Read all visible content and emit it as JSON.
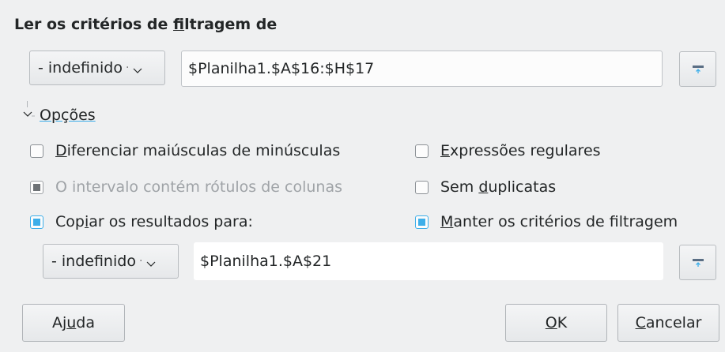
{
  "heading": {
    "pre": "Ler os critérios de ",
    "accel": "f",
    "post": "iltragem de"
  },
  "source": {
    "combo_value": "- indefinido",
    "range_value": "$Planilha1.$A$16:$H$17"
  },
  "options_expander": {
    "label": "Opções",
    "expanded": true
  },
  "options": {
    "case_sensitive": {
      "pre": "",
      "accel": "D",
      "post": "iferenciar maiúsculas de minúsculas",
      "checked": false
    },
    "regex": {
      "pre": "",
      "accel": "E",
      "post": "xpressões regulares",
      "checked": false
    },
    "contains_labels": {
      "label": "O intervalo contém rótulos de colunas",
      "checked": true,
      "disabled": true
    },
    "no_duplicates": {
      "pre": "Sem ",
      "accel": "d",
      "post": "uplicatas",
      "checked": false
    },
    "copy_results": {
      "pre": "Cop",
      "accel": "i",
      "post": "ar os resultados para:",
      "checked": true
    },
    "keep_criteria": {
      "pre": "",
      "accel": "M",
      "post": "anter os critérios de filtragem",
      "checked": true
    }
  },
  "copy_target": {
    "combo_value": "- indefinido",
    "range_value": "$Planilha1.$A$21"
  },
  "buttons": {
    "help": {
      "pre": "Aj",
      "accel": "u",
      "post": "da"
    },
    "ok": {
      "pre": "",
      "accel": "O",
      "post": "K"
    },
    "cancel": {
      "pre": "",
      "accel": "C",
      "post": "ancelar"
    }
  },
  "icons": {
    "shrink": "shrink-dialog-icon",
    "chevron": "chevron-down-icon"
  },
  "colors": {
    "accent": "#3daee9",
    "background": "#eff0f1"
  }
}
